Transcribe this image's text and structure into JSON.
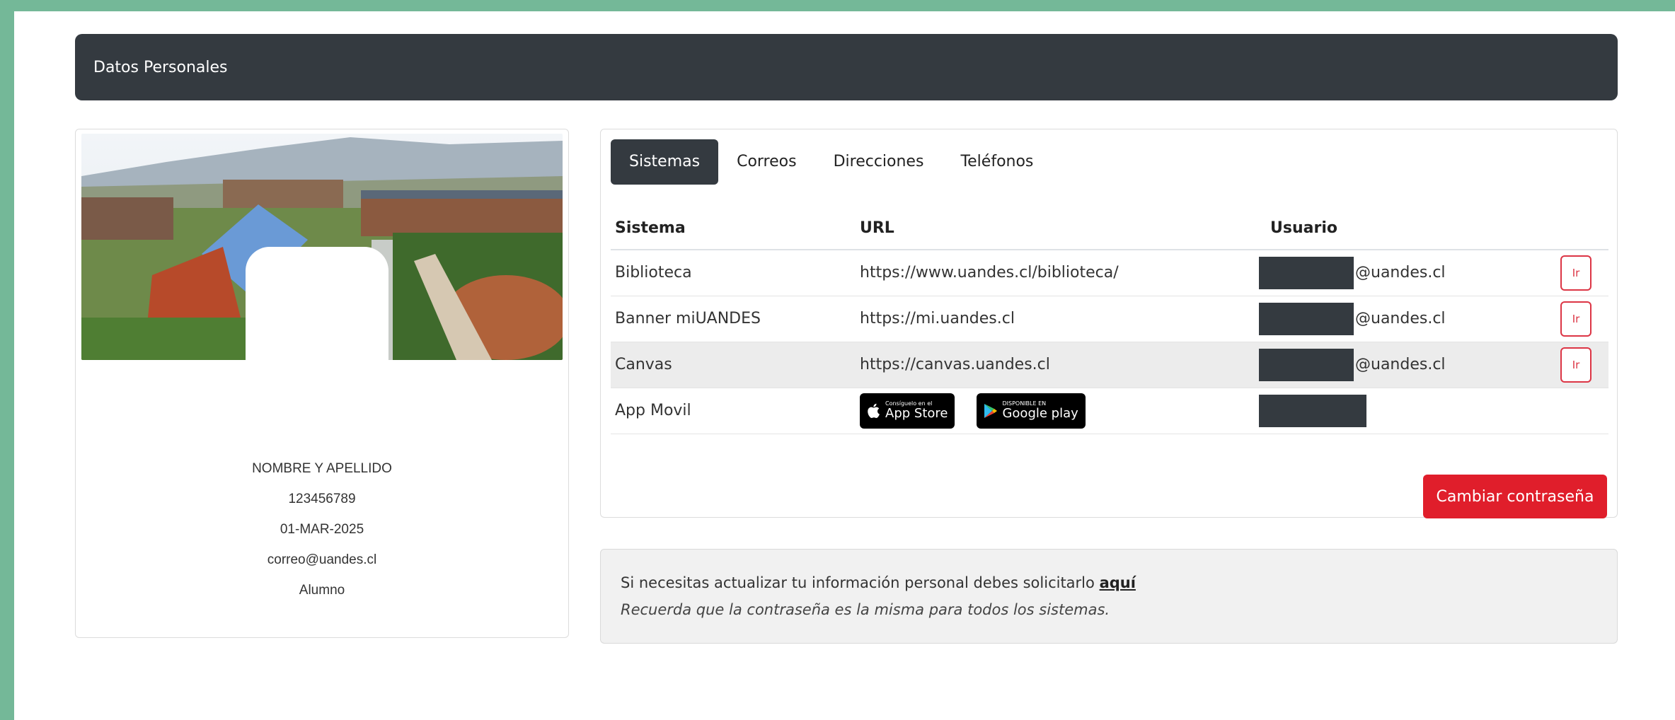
{
  "header": {
    "title": "Datos Personales"
  },
  "profile": {
    "name": "NOMBRE Y APELLIDO",
    "id": "123456789",
    "date": "01-MAR-2025",
    "email": "correo@uandes.cl",
    "role": "Alumno"
  },
  "tabs": [
    {
      "label": "Sistemas",
      "active": true
    },
    {
      "label": "Correos"
    },
    {
      "label": "Direcciones"
    },
    {
      "label": "Teléfonos"
    }
  ],
  "table": {
    "headers": {
      "system": "Sistema",
      "url": "URL",
      "user": "Usuario"
    },
    "rows": [
      {
        "system": "Biblioteca",
        "url": "https://www.uandes.cl/biblioteca/",
        "user_domain": "@uandes.cl",
        "action": "Ir"
      },
      {
        "system": "Banner miUANDES",
        "url": "https://mi.uandes.cl",
        "user_domain": "@uandes.cl",
        "action": "Ir"
      },
      {
        "system": "Canvas",
        "url": "https://canvas.uandes.cl",
        "user_domain": "@uandes.cl",
        "action": "Ir"
      },
      {
        "system": "App Movil"
      }
    ]
  },
  "badges": {
    "appstore": {
      "small": "Consíguelo en el",
      "big": "App Store"
    },
    "googleplay": {
      "small": "DISPONIBLE EN",
      "big": "Google play"
    }
  },
  "buttons": {
    "change_password": "Cambiar contraseña"
  },
  "notice": {
    "line1": "Si necesitas actualizar tu información personal debes solicitarlo",
    "link": "aquí",
    "line2": "Recuerda que la contraseña es la misma para todos los sistemas."
  },
  "colors": {
    "accent_bg": "#74b898",
    "header": "#343a40",
    "danger": "#e01e2b"
  },
  "icons": [
    "apple-icon",
    "google-play-icon"
  ]
}
